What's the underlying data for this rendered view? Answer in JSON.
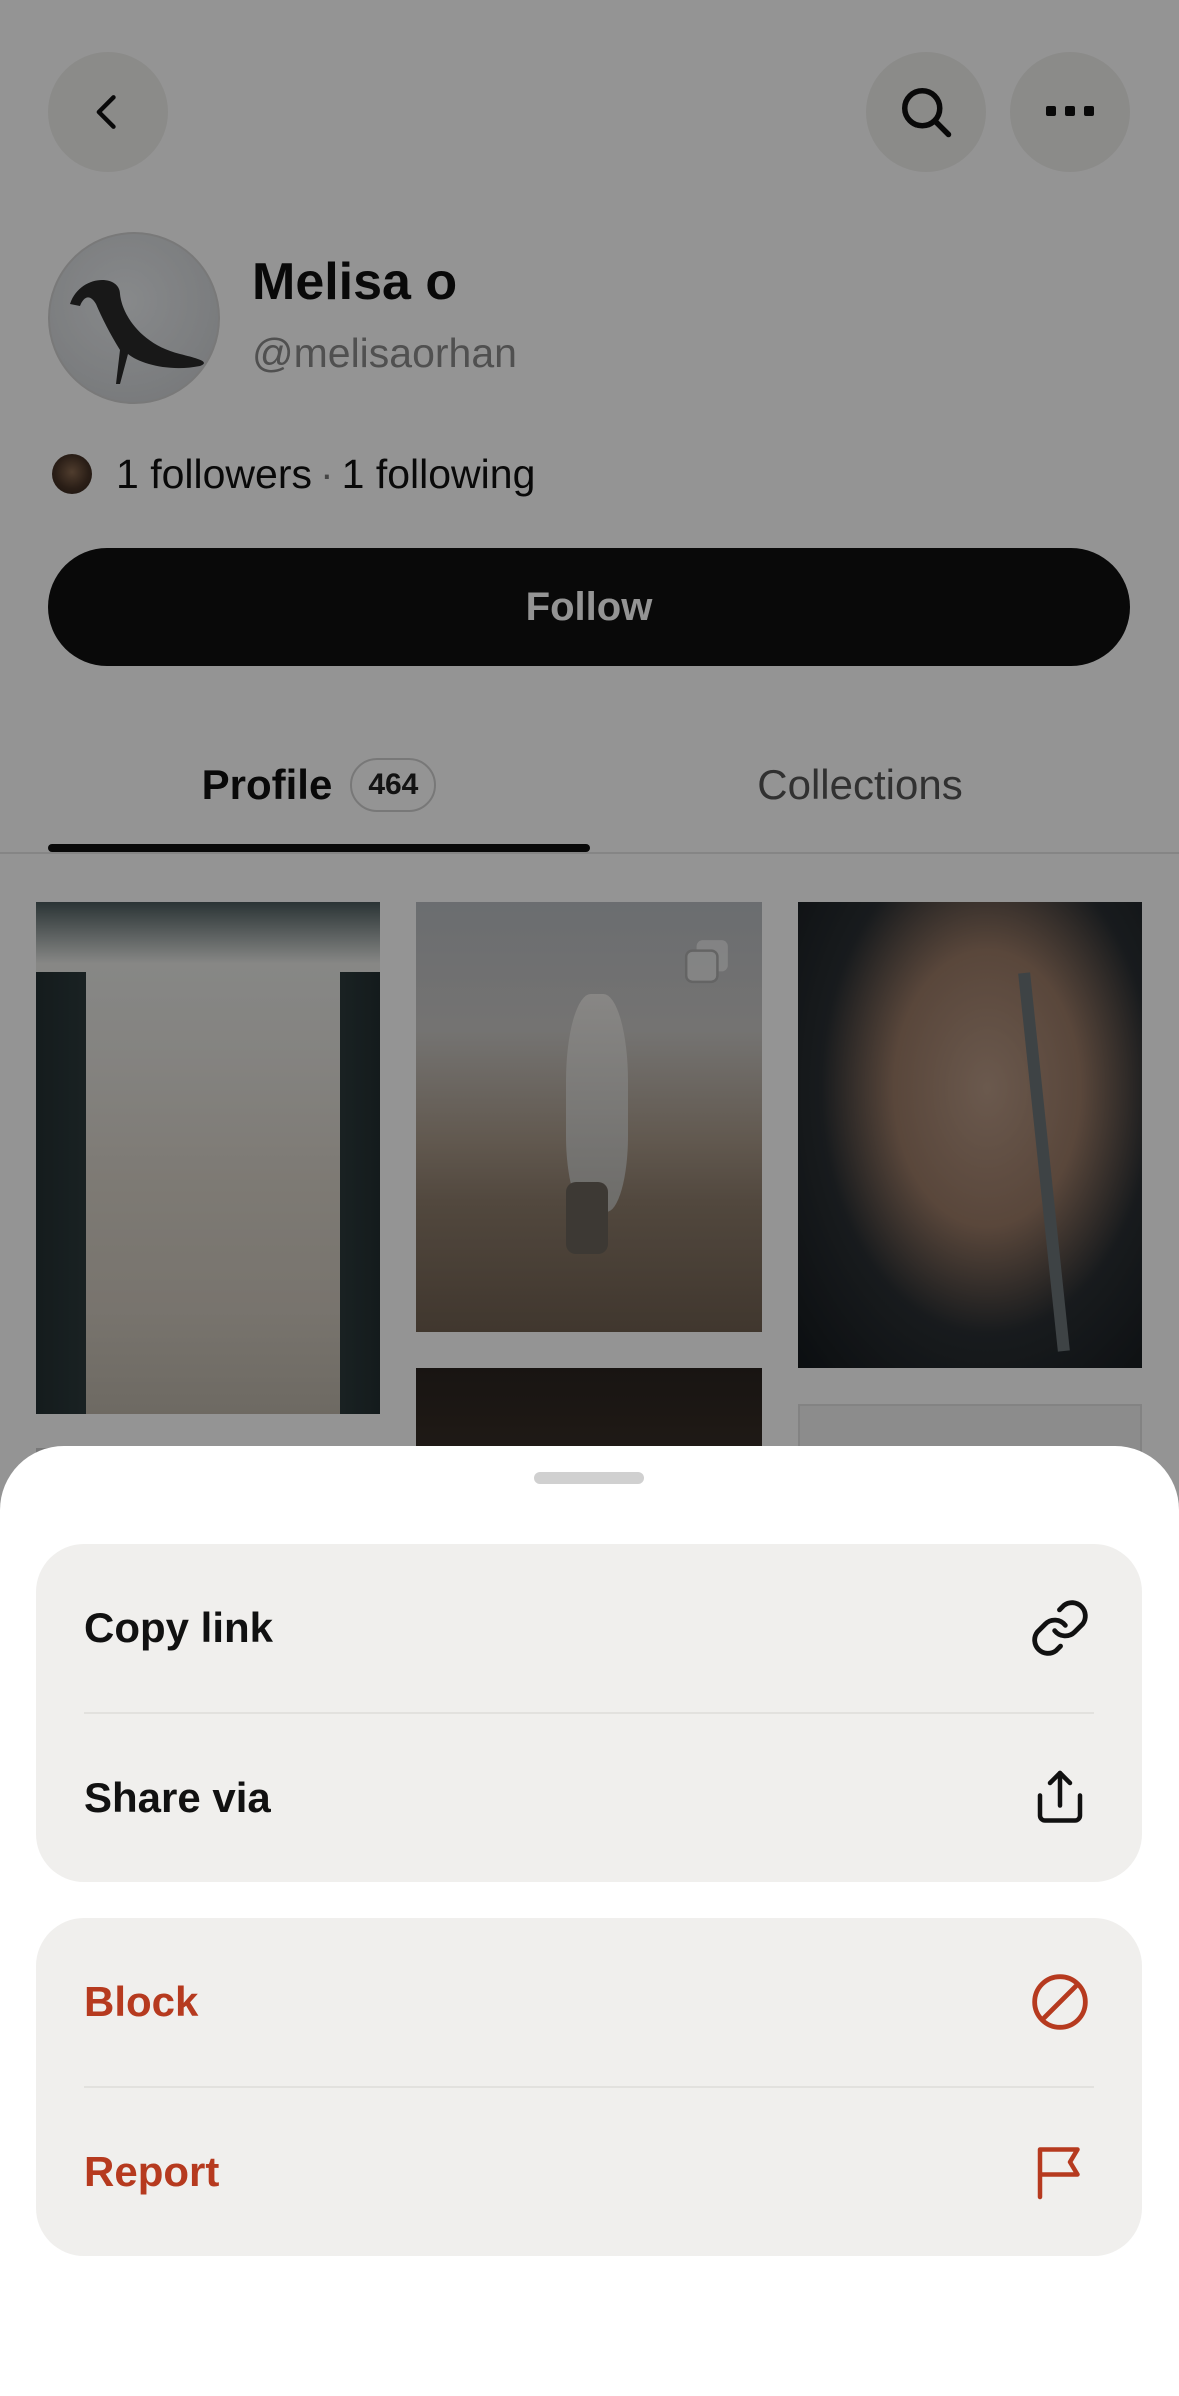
{
  "profile": {
    "name": "Melisa o",
    "handle": "@melisaorhan",
    "followers": "1 followers",
    "separator": "·",
    "following": "1 following",
    "follow_label": "Follow"
  },
  "header": {
    "back_icon": "chevron-left-icon",
    "search_icon": "search-icon",
    "more_icon": "more-horizontal-icon"
  },
  "tabs": {
    "profile_label": "Profile",
    "profile_count": "464",
    "collections_label": "Collections"
  },
  "sheet": {
    "group1": [
      {
        "label": "Copy link",
        "icon": "link-icon"
      },
      {
        "label": "Share via",
        "icon": "share-icon"
      }
    ],
    "group2": [
      {
        "label": "Block",
        "icon": "block-icon"
      },
      {
        "label": "Report",
        "icon": "flag-icon"
      }
    ]
  },
  "colors": {
    "danger": "#b63a1f",
    "follow_button_bg": "#111111",
    "sheet_item_bg": "#f0efed"
  }
}
